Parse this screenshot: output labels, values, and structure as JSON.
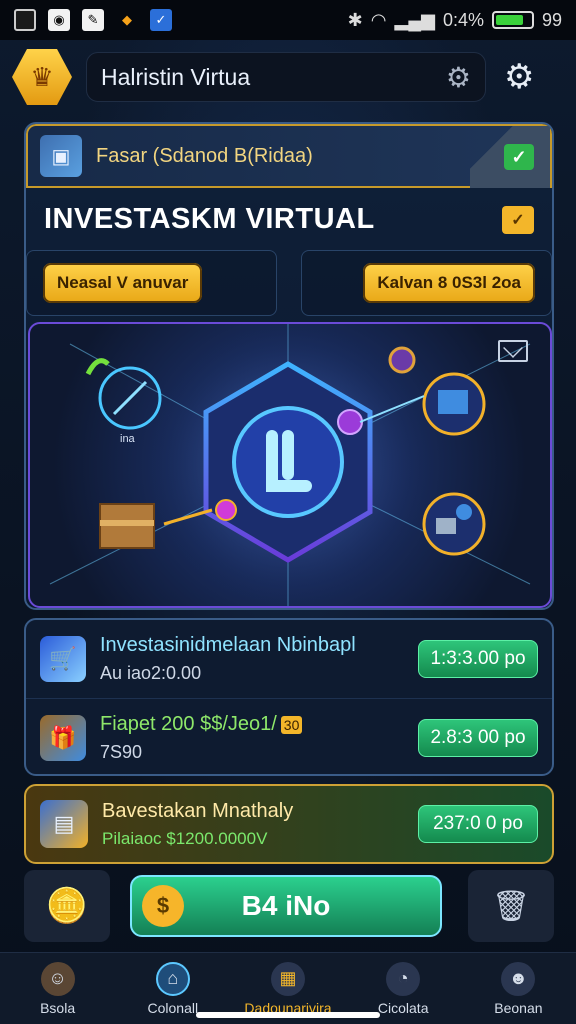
{
  "status_bar": {
    "time": "0:4%",
    "battery_text": "99",
    "icons": [
      "app-icon",
      "app-icon",
      "app-icon",
      "app-icon",
      "app-icon"
    ]
  },
  "header": {
    "search_text": "Halristin Virtua",
    "icons": [
      "settings-icon",
      "gear-icon"
    ]
  },
  "hero": {
    "top_label": "Fasar (Sdanod B(Ridaa)",
    "title": "INVESTASKM VIRTUAL",
    "left_button": "Neasal V anuvar",
    "right_button": "Kalvan 8 0S3l 2oa"
  },
  "art_labels": {
    "left": "ina"
  },
  "rows": [
    {
      "title": "Investasinidmelaan Nbinbapl",
      "sub": "Au iao2:0.00",
      "value": "1:3:3.00 po"
    },
    {
      "title": "Fiapet 200 $$/Jeo1/",
      "tag": "30",
      "sub": "7S90",
      "value": "2.8:3 00 po"
    }
  ],
  "gold_card": {
    "title": "Bavestakan Mnathaly",
    "sub": "Pilaiaoc $1200.0000V",
    "value": "237:0 0 po"
  },
  "action": {
    "main_label": "B4 iNo"
  },
  "bottom_nav": [
    {
      "label": "Bsola",
      "icon": "avatar-icon"
    },
    {
      "label": "Colonall",
      "icon": "home-icon"
    },
    {
      "label": "Dadounarivira",
      "icon": "grid-icon"
    },
    {
      "label": "Cicolata",
      "icon": "chart-icon"
    },
    {
      "label": "Beonan",
      "icon": "profile-icon"
    }
  ],
  "colors": {
    "accent_gold": "#f3b62a",
    "accent_green": "#2ec57a",
    "accent_cyan": "#8fe3ff",
    "bg": "#0b1424"
  }
}
